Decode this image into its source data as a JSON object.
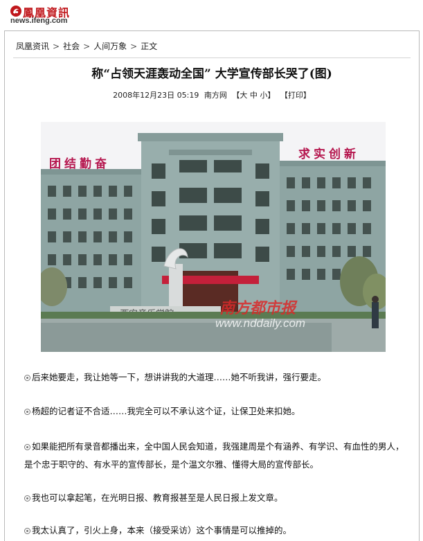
{
  "header": {
    "logo_cn": "鳳凰資訊",
    "logo_url": "news.ifeng.com",
    "logo_icon": "phoenix-logo-icon"
  },
  "breadcrumb": [
    "凤凰资讯",
    "社会",
    "人间万象",
    "正文"
  ],
  "breadcrumb_separator": ">",
  "article": {
    "title": "称“占领天涯轰动全国”  大学宣传部长哭了(图)",
    "date": "2008年12月23日 05:19",
    "source": "南方网",
    "font_size_label": "【大 中 小】",
    "print_label": "【打印】"
  },
  "photo": {
    "banner_left": "团结勤奋",
    "banner_right": "求实创新",
    "building_sign": "西安音乐学院",
    "watermark_cn": "南方都市报",
    "watermark_url": "www.nddaily.com",
    "colors": {
      "sky": "#f2f2f4",
      "building": "#8ea5a3",
      "banner_text": "#b5164e",
      "watermark": "#d92a2a"
    }
  },
  "paragraphs": [
    "后来她要走，我让她等一下，想讲讲我的大道理……她不听我讲，强行要走。",
    "杨超的记者证不合适……我完全可以不承认这个证，让保卫处来扣她。",
    "如果能把所有录音都播出来，全中国人民会知道，我强建周是个有涵养、有学识、有血性的男人，是个忠于职守的、有水平的宣传部长，是个温文尔雅、懂得大局的宣传部长。",
    "我也可以拿起笔，在光明日报、教育报甚至是人民日报上发文章。",
    "我太认真了，引火上身，本来（接受采访）这个事情是可以推掉的。"
  ],
  "bullet_icon": "circle-bullet-icon"
}
